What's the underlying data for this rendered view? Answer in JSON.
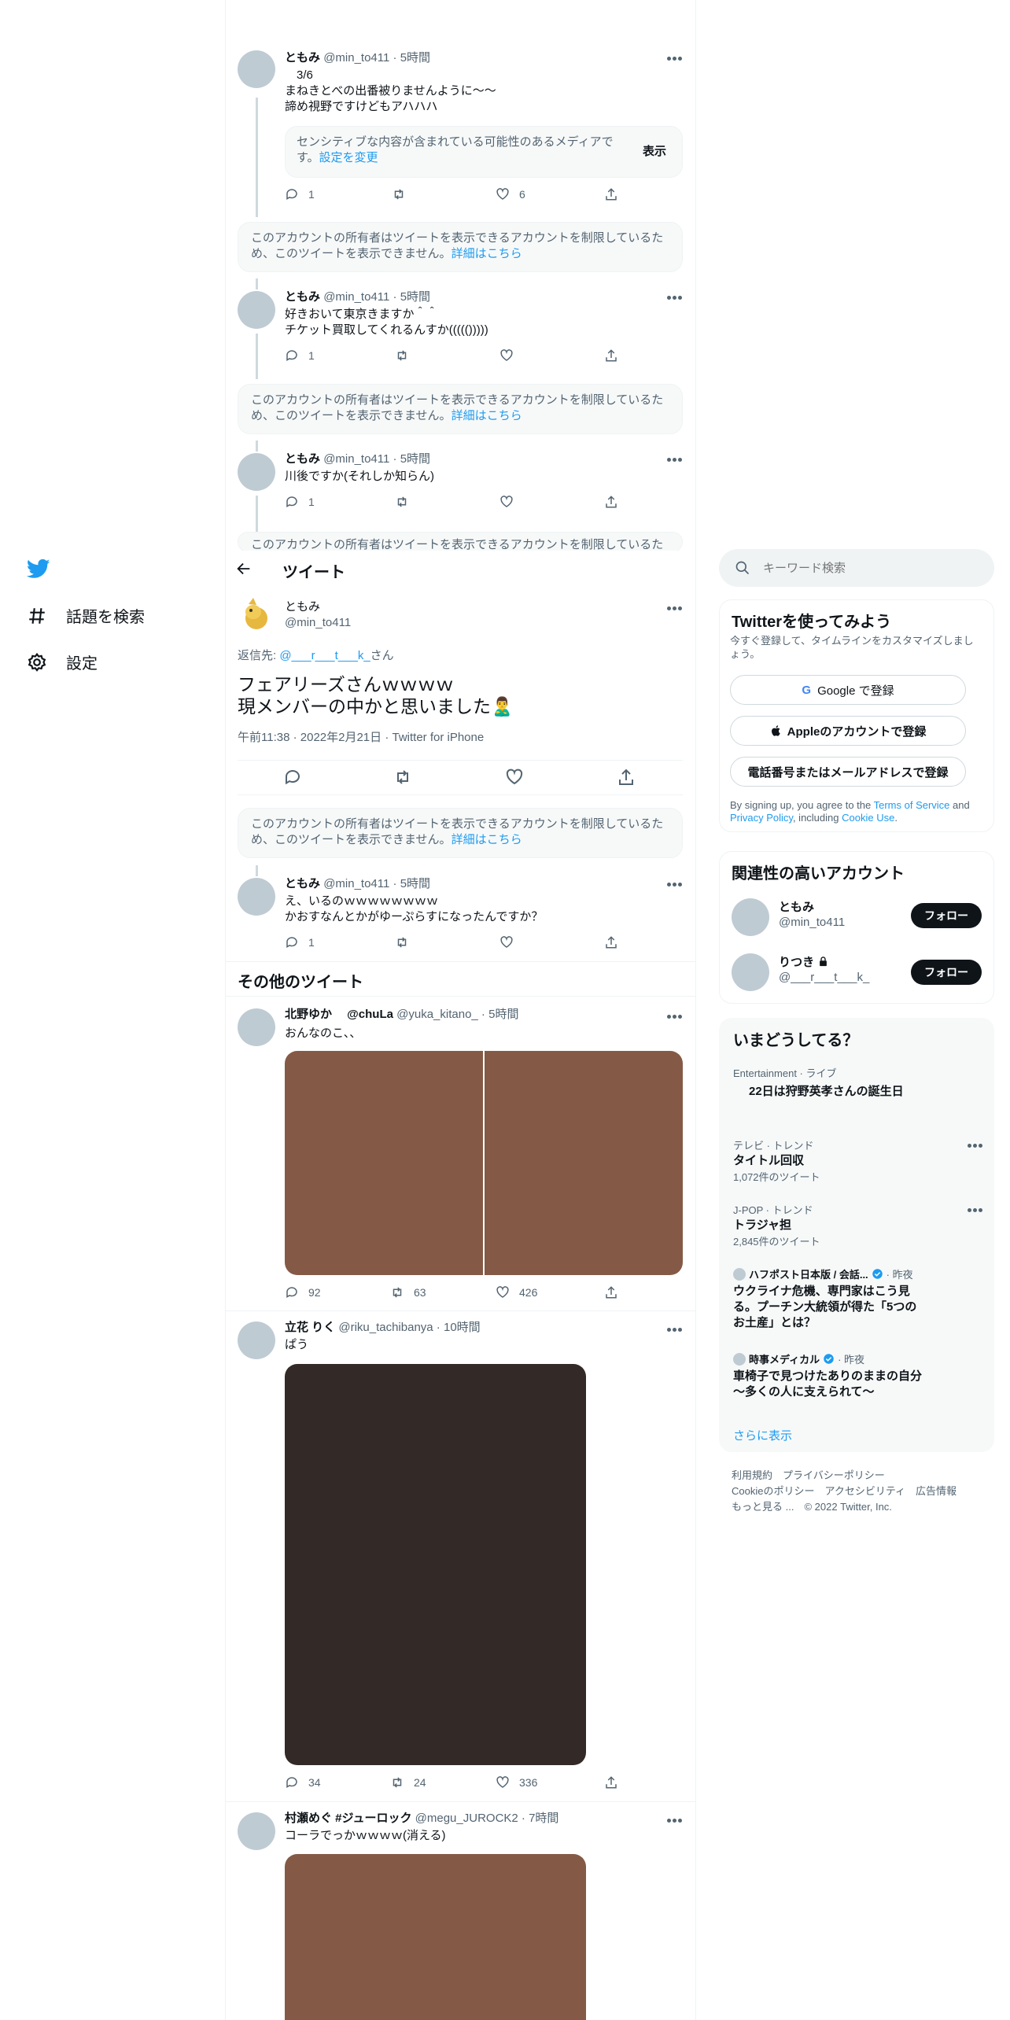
{
  "nav": {
    "explore_label": "話題を検索",
    "settings_label": "設定"
  },
  "tweets_top": [
    {
      "name": "ともみ",
      "handle": "@min_to411",
      "time": "5時間",
      "text": "　3/6\nまねきとべの出番被りませんように〜〜\n諦め視野ですけどもアハハハ",
      "sensitive_text": "センシティブな内容が含まれている可能性のあるメディアです。",
      "sensitive_link": "設定を変更",
      "sensitive_button": "表示",
      "reply": "1",
      "retweet": "",
      "like": "6"
    },
    {
      "name": "ともみ",
      "handle": "@min_to411",
      "time": "5時間",
      "text": "好きおいて東京きますか＾＾\nチケット買取してくれるんすか((((()))))",
      "reply": "1"
    },
    {
      "name": "ともみ",
      "handle": "@min_to411",
      "time": "5時間",
      "text": "川後ですか(それしか知らん)",
      "reply": "1"
    }
  ],
  "restricted": {
    "text": "このアカウントの所有者はツイートを表示できるアカウントを制限しているため、このツイートを表示できません。",
    "link": "詳細はこちら",
    "partial": "このアカウントの所有者はツイートを表示できるアカウントを制限しているた"
  },
  "header": {
    "title": "ツイート"
  },
  "main_tweet": {
    "name": "ともみ",
    "handle": "@min_to411",
    "reply_prefix": "返信先: ",
    "reply_to": "@___r___t___k_",
    "reply_suffix": "さん",
    "text_line1": "フェアリーズさんｗｗｗｗ",
    "text_line2": "現メンバーの中かと思いました🙎‍♂️",
    "meta": "午前11:38 · 2022年2月21日 · Twitter for iPhone"
  },
  "reply_tweet": {
    "name": "ともみ",
    "handle": "@min_to411",
    "time": "5時間",
    "text": "え、いるのｗｗｗｗｗｗｗｗ\nかおすなんとかがゆーぷらすになったんですか？",
    "reply": "1"
  },
  "more_tweets": {
    "title": "その他のツイート",
    "items": [
      {
        "name": "北野ゆか　 @chuLa",
        "handle": "@yuka_kitano_",
        "time": "5時間",
        "text": "おんなのこ、、",
        "reply": "92",
        "retweet": "63",
        "like": "426",
        "media_color": "#845a46"
      },
      {
        "name": "立花 りく",
        "handle": "@riku_tachibanya",
        "time": "10時間",
        "text": "ぱう",
        "reply": "34",
        "retweet": "24",
        "like": "336",
        "media_color": "#332927"
      },
      {
        "name": "村瀬めぐ #ジューロック",
        "handle": "@megu_JUROCK2",
        "time": "7時間",
        "text": "コーラでっかｗｗｗｗ(消える)",
        "media_color": "#845a46"
      }
    ]
  },
  "search": {
    "placeholder": "キーワード検索"
  },
  "signup": {
    "title": "Twitterを使ってみよう",
    "subtitle": "今すぐ登録して、タイムラインをカスタマイズしましょう。",
    "google": "Google で登録",
    "apple": "Appleのアカウントで登録",
    "phone": "電話番号またはメールアドレスで登録",
    "terms_pre": "By signing up, you agree to the ",
    "terms": "Terms of Service",
    "and": " and ",
    "privacy": "Privacy Policy",
    "including": ", including ",
    "cookie": "Cookie Use",
    "end": "."
  },
  "related": {
    "title": "関連性の高いアカウント",
    "follow_label": "フォロー",
    "accounts": [
      {
        "name": "ともみ",
        "handle": "@min_to411"
      },
      {
        "name": "りつき",
        "handle": "@___r___t___k_"
      }
    ]
  },
  "trends": {
    "title": "いまどうしてる？",
    "live_meta": "Entertainment · ライブ",
    "live_title": "22日は狩野英孝さんの誕生日",
    "items": [
      {
        "meta": "テレビ · トレンド",
        "title": "タイトル回収",
        "count": "1,072件のツイート"
      },
      {
        "meta": "J-POP · トレンド",
        "title": "トラジャ担",
        "count": "2,845件のツイート"
      }
    ],
    "news": [
      {
        "source": "ハフポスト日本版 / 会話...",
        "time": "· 昨夜",
        "title": "ウクライナ危機、専門家はこう見る。プーチン大統領が得た「5つのお土産」とは？"
      },
      {
        "source": "時事メディカル",
        "time": "· 昨夜",
        "title": "車椅子で見つけたありのままの自分～多くの人に支えられて～"
      }
    ],
    "show_more": "さらに表示"
  },
  "footer": {
    "line1": "利用規約　プライバシーポリシー",
    "line2": "Cookieのポリシー　アクセシビリティ　広告情報",
    "line3": "もっと見る ...　© 2022 Twitter, Inc."
  },
  "colors": {
    "accent": "#1d9bf0",
    "text": "#0f1419",
    "secondary": "#536471",
    "like_red": "#f91880"
  }
}
